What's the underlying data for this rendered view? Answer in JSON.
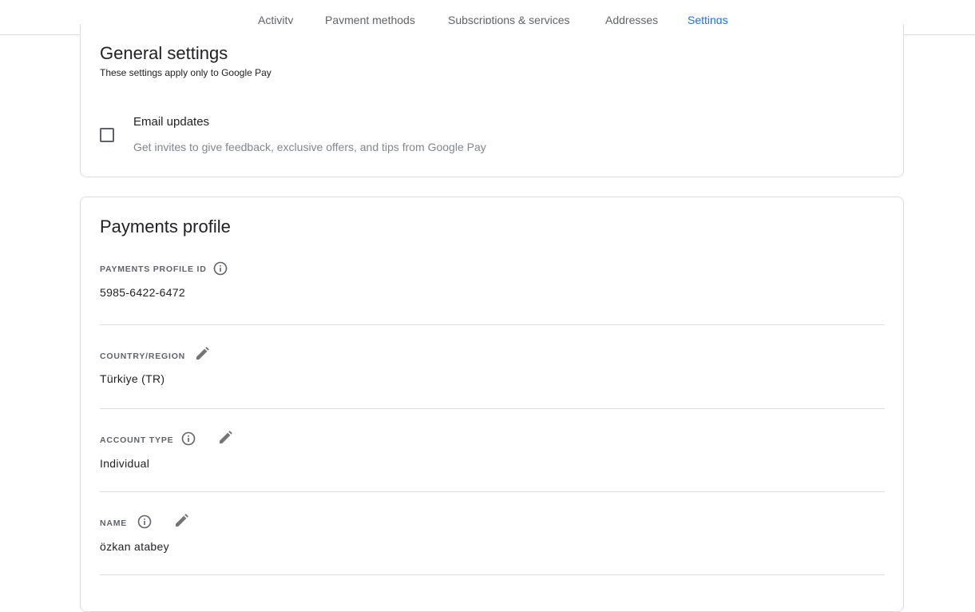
{
  "nav": {
    "tabs": [
      {
        "label": "Activity",
        "active": false
      },
      {
        "label": "Payment methods",
        "active": false
      },
      {
        "label": "Subscriptions & services",
        "active": false
      },
      {
        "label": "Addresses",
        "active": false
      },
      {
        "label": "Settings",
        "active": true
      }
    ]
  },
  "general": {
    "title": "General settings",
    "subtitle": "These settings apply only to Google Pay",
    "email_updates": {
      "label": "Email updates",
      "description": "Get invites to give feedback, exclusive offers, and tips from Google Pay",
      "checked": false
    }
  },
  "profile": {
    "title": "Payments profile",
    "fields": [
      {
        "label": "PAYMENTS PROFILE ID",
        "value": "5985-6422-6472",
        "info_icon": "info-icon",
        "edit_icon": null
      },
      {
        "label": "COUNTRY/REGION",
        "value": "Türkiye (TR)",
        "info_icon": null,
        "edit_icon": "pencil-icon"
      },
      {
        "label": "ACCOUNT TYPE",
        "value": "Individual",
        "info_icon": "info-icon",
        "edit_icon": "pencil-icon"
      },
      {
        "label": "NAME",
        "value": "özkan atabey",
        "info_icon": "info-icon",
        "edit_icon": "pencil-icon"
      }
    ]
  },
  "colors": {
    "accent": "#1a73e8",
    "text": "#202124",
    "muted": "#5f6368",
    "border": "#dadce0"
  }
}
